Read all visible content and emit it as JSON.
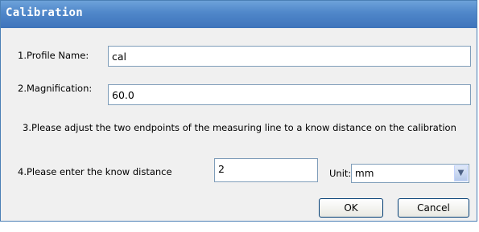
{
  "window": {
    "title": "Calibration"
  },
  "profile": {
    "label": "1.Profile Name:",
    "value": "cal"
  },
  "magnification": {
    "label": "2.Magnification:",
    "value": "60.0"
  },
  "instruction": "3.Please adjust the two endpoints of the measuring line to a know distance on the calibration",
  "distance": {
    "label": "4.Please enter the know distance",
    "value": "2"
  },
  "unit": {
    "label": "Unit:",
    "selected": "mm"
  },
  "buttons": {
    "ok": "OK",
    "cancel": "Cancel"
  },
  "colors": {
    "titlebar": "#4f86c9",
    "field_border": "#7f9db9",
    "button_border": "#003c74"
  },
  "icons": {
    "dropdown": "chevron-down-icon"
  }
}
